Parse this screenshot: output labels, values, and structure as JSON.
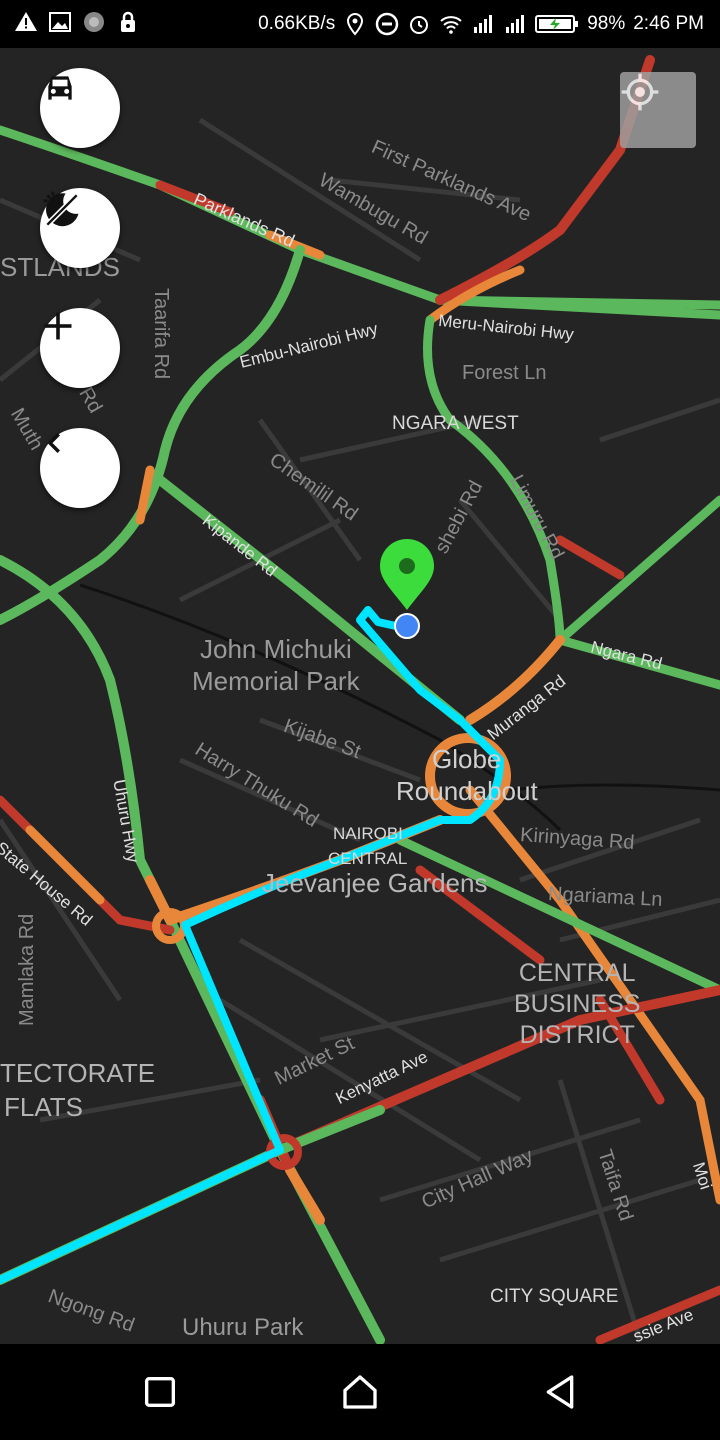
{
  "status_bar": {
    "net_speed": "0.66KB/s",
    "battery": "98%",
    "time": "2:46 PM",
    "icons_left": [
      "warning-icon",
      "image-icon",
      "loading-icon",
      "lock-icon"
    ],
    "icons_right": [
      "location-icon",
      "dnd-icon",
      "alarm-icon",
      "wifi-icon",
      "signal-icon",
      "signal-icon",
      "battery-icon"
    ]
  },
  "map": {
    "labels": {
      "parklands_rd": "Parklands Rd",
      "first_parklands": "First Parklands Ave",
      "wambugu": "Wambugu Rd",
      "westlands": "STLANDS",
      "taarifa": "Taarifa Rd",
      "embu_nairobi": "Embu-Nairobi Hwy",
      "meru_nairobi": "Meru-Nairobi Hwy",
      "forest_ln": "Forest Ln",
      "ngara_west": "NGARA WEST",
      "jjo_rd": "jjo Rd",
      "muth": "Muth",
      "chemilil": "Chemilil Rd",
      "limuru": "Limuru Rd",
      "shebi": "shebi Rd",
      "kipande": "Kipande Rd",
      "john_michuki": "John Michuki",
      "memorial_park": "Memorial Park",
      "muranga": "Muranga Rd",
      "ngara_rd": "Ngara Rd",
      "kijabe": "Kijabe St",
      "globe": "Globe",
      "roundabout": "Roundabout",
      "uhuru_hwy": "Uhuru Hwy",
      "harry_thuku": "Harry Thuku Rd",
      "kirinyaga": "Kirinyaga Rd",
      "state_house": "State House Rd",
      "nairobi": "NAIROBI",
      "central": "CENTRAL",
      "jeevanjee": "Jeevanjee Gardens",
      "ngariama": "Ngariama Ln",
      "mamlaka": "Mamlaka Rd",
      "cbd_1": "CENTRAL",
      "cbd_2": "BUSINESS",
      "cbd_3": "DISTRICT",
      "tectorate": "TECTORATE",
      "flats": "FLATS",
      "market_st": "Market St",
      "kenyatta": "Kenyatta Ave",
      "city_hall": "City Hall Way",
      "taifa": "Taifa Rd",
      "moi": "Moi",
      "ngong": "Ngong Rd",
      "city_square": "CITY SQUARE",
      "uhuru_park": "Uhuru Park",
      "haile": "ssie Ave"
    }
  },
  "controls": {
    "car": "car-icon",
    "night": "night-mode-icon",
    "zoom_in": "plus-icon",
    "back": "chevron-left-icon",
    "locate": "crosshair-icon"
  },
  "colors": {
    "traffic_green": "#5cb85c",
    "traffic_orange": "#e8873a",
    "traffic_red": "#c0392b",
    "route": "#00e5ff",
    "marker": "#3ddc3d",
    "origin": "#4285f4"
  }
}
